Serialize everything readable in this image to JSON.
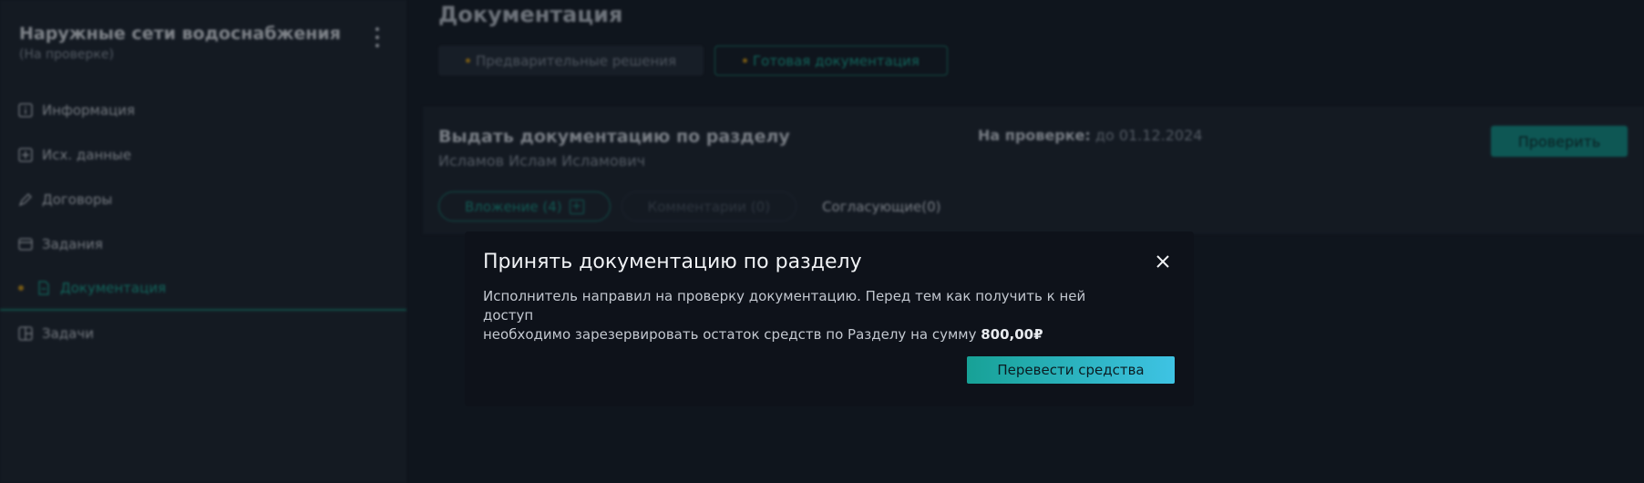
{
  "sidebar": {
    "project_title": "Наружные сети водоснабжения",
    "project_status": "(На проверке)",
    "items": [
      {
        "label": "Информация",
        "icon": "info-icon"
      },
      {
        "label": "Исх. данные",
        "icon": "plus-box-icon"
      },
      {
        "label": "Договоры",
        "icon": "pen-icon"
      },
      {
        "label": "Задания",
        "icon": "calendar-icon"
      },
      {
        "label": "Документация",
        "icon": "document-icon",
        "active": true
      },
      {
        "label": "Задачи",
        "icon": "tasks-icon"
      }
    ]
  },
  "main": {
    "page_title": "Документация",
    "tabs": [
      {
        "label": "Предварительные решения"
      },
      {
        "label": "Готовая документация",
        "active": true
      }
    ],
    "task": {
      "title": "Выдать документацию по разделу",
      "person": "Исламов Ислам Исламович",
      "status_label": "На проверке:",
      "status_value": " до 01.12.2024",
      "verify_label": "Проверить",
      "attach_label": "Вложение (4)",
      "comments_label": "Комментарии (0)",
      "approvers_label": "Согласующие(0)"
    }
  },
  "modal": {
    "title": "Принять документацию по разделу",
    "body_line1": "Исполнитель направил на проверку документацию. Перед тем как получить к ней доступ",
    "body_line2": "необходимо зарезервировать остаток средств по Разделу на сумму ",
    "amount": "800,00₽",
    "button_label": "Перевести средства"
  },
  "colors": {
    "accent": "#1aa591",
    "status_dot": "#c69118",
    "modal_bg": "#0e121a",
    "button_gradient_start": "#17a196",
    "button_gradient_end": "#3ec3e4"
  }
}
